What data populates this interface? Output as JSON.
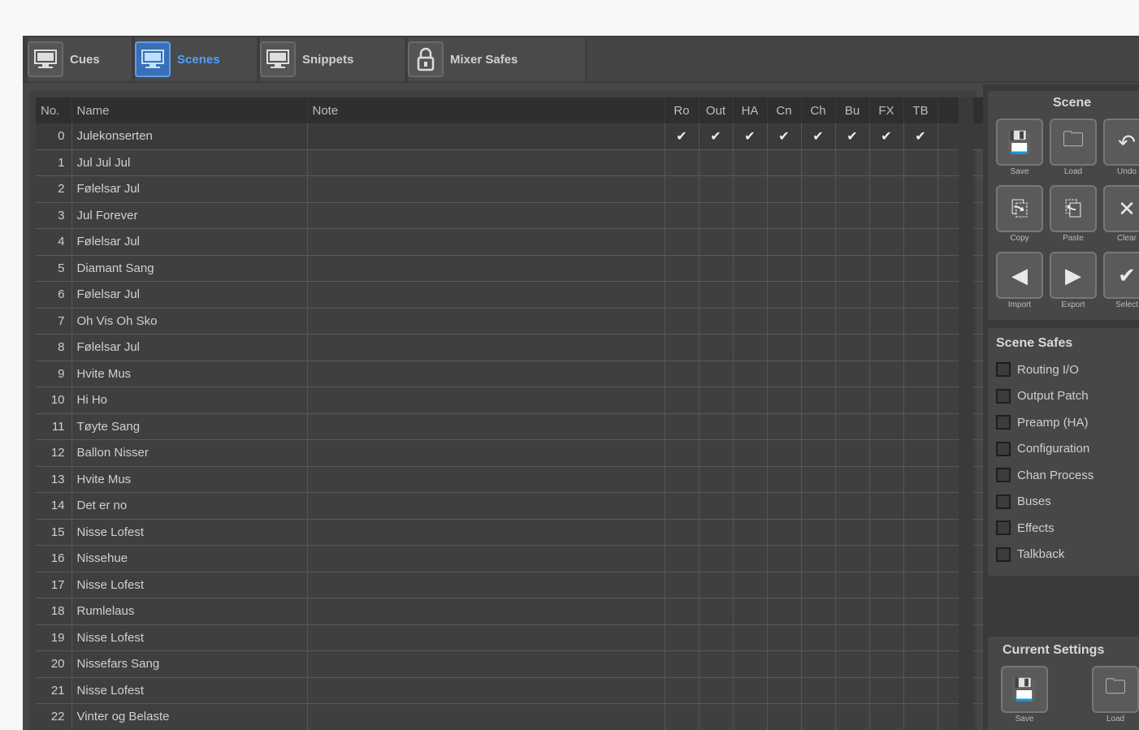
{
  "tabs": [
    {
      "label": "Cues",
      "icon": "monitor-icon",
      "active": false
    },
    {
      "label": "Scenes",
      "icon": "monitor-icon",
      "active": true
    },
    {
      "label": "Snippets",
      "icon": "monitor-icon",
      "active": false
    },
    {
      "label": "Mixer Safes",
      "icon": "lock-icon",
      "active": false
    }
  ],
  "table": {
    "columns": {
      "no": "No.",
      "name": "Name",
      "note": "Note",
      "flags": [
        "Ro",
        "Out",
        "HA",
        "Cn",
        "Ch",
        "Bu",
        "FX",
        "TB"
      ]
    },
    "rows": [
      {
        "no": "0",
        "name": "Julekonserten",
        "checked": true
      },
      {
        "no": "1",
        "name": "Jul Jul Jul",
        "checked": false
      },
      {
        "no": "2",
        "name": "Følelsar Jul",
        "checked": false
      },
      {
        "no": "3",
        "name": "Jul Forever",
        "checked": false
      },
      {
        "no": "4",
        "name": "Følelsar Jul",
        "checked": false
      },
      {
        "no": "5",
        "name": "Diamant Sang",
        "checked": false
      },
      {
        "no": "6",
        "name": "Følelsar Jul",
        "checked": false
      },
      {
        "no": "7",
        "name": "Oh Vis Oh Sko",
        "checked": false
      },
      {
        "no": "8",
        "name": "Følelsar Jul",
        "checked": false
      },
      {
        "no": "9",
        "name": "Hvite Mus",
        "checked": false
      },
      {
        "no": "10",
        "name": "Hi Ho",
        "checked": false
      },
      {
        "no": "11",
        "name": "Tøyte Sang",
        "checked": false
      },
      {
        "no": "12",
        "name": "Ballon Nisser",
        "checked": false
      },
      {
        "no": "13",
        "name": "Hvite Mus",
        "checked": false
      },
      {
        "no": "14",
        "name": "Det er no",
        "checked": false
      },
      {
        "no": "15",
        "name": "Nisse Lofest",
        "checked": false
      },
      {
        "no": "16",
        "name": "Nissehue",
        "checked": false
      },
      {
        "no": "17",
        "name": "Nisse Lofest",
        "checked": false
      },
      {
        "no": "18",
        "name": "Rumlelaus",
        "checked": false
      },
      {
        "no": "19",
        "name": "Nisse Lofest",
        "checked": false
      },
      {
        "no": "20",
        "name": "Nissefars Sang",
        "checked": false
      },
      {
        "no": "21",
        "name": "Nisse Lofest",
        "checked": false
      },
      {
        "no": "22",
        "name": "Vinter og Belaste",
        "checked": false
      }
    ],
    "check_glyph": "✔"
  },
  "scene_panel": {
    "title": "Scene",
    "buttons": [
      {
        "label": "Save",
        "icon": "save-icon",
        "glyph": "💾"
      },
      {
        "label": "Load",
        "icon": "folder-icon",
        "glyph": "🗀"
      },
      {
        "label": "Undo",
        "icon": "undo-icon",
        "glyph": "↶"
      },
      {
        "label": "Copy",
        "icon": "copy-icon",
        "glyph": "⎘"
      },
      {
        "label": "Paste",
        "icon": "paste-icon",
        "glyph": "⎗"
      },
      {
        "label": "Clear",
        "icon": "clear-icon",
        "glyph": "✕"
      },
      {
        "label": "Import",
        "icon": "import-icon",
        "glyph": "◀"
      },
      {
        "label": "Export",
        "icon": "export-icon",
        "glyph": "▶"
      },
      {
        "label": "Select",
        "icon": "check-icon",
        "glyph": "✔"
      }
    ]
  },
  "scene_safes": {
    "title": "Scene Safes",
    "items": [
      "Routing I/O",
      "Output Patch",
      "Preamp (HA)",
      "Configuration",
      "Chan Process",
      "Buses",
      "Effects",
      "Talkback"
    ]
  },
  "current_settings": {
    "title": "Current Settings",
    "buttons": [
      {
        "label": "Save",
        "icon": "save-icon",
        "glyph": "💾"
      },
      {
        "label": "Load",
        "icon": "folder-icon",
        "glyph": "🗀"
      }
    ]
  },
  "colors": {
    "accent": "#4ea0ff",
    "panel": "#474747",
    "grid": "#3f3f3f"
  }
}
